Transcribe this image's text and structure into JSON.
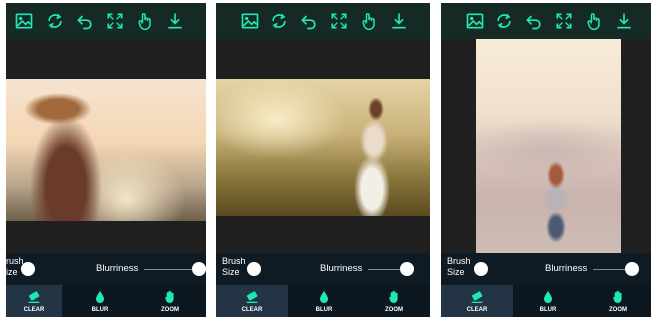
{
  "toolbar": {
    "icons": [
      "image-icon",
      "reset-icon",
      "undo-icon",
      "fullscreen-icon",
      "touch-icon",
      "download-icon"
    ]
  },
  "controls": {
    "brush_size_label_1": "Brush",
    "brush_size_label_2": "Size",
    "blurriness_label": "Blurriness"
  },
  "panel1": {
    "brush_label_1": "rush",
    "brush_label_2": "ize"
  },
  "tabs": {
    "clear": "CLEAR",
    "blur": "BLUR",
    "zoom": "ZOOM"
  },
  "colors": {
    "accent": "#1de9b6",
    "topbar": "#162a25",
    "bottombar": "#0d1720",
    "active_tab": "#233544"
  }
}
